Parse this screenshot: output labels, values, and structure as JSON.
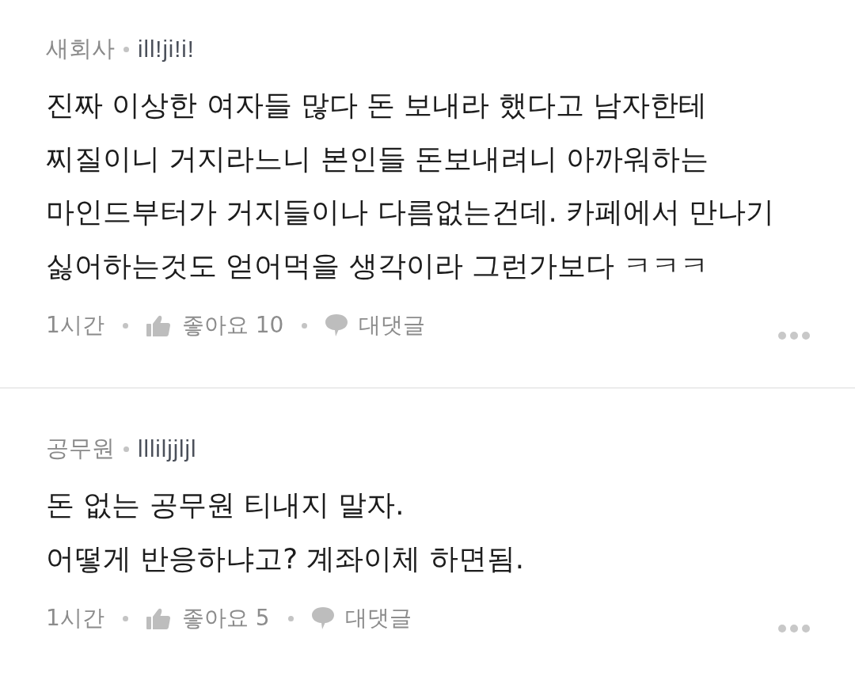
{
  "comments": [
    {
      "author": "새회사",
      "nickname": "ill!ji!i!",
      "lines": [
        "진짜 이상한 여자들 많다 돈 보내라 했다고 남자한테",
        "찌질이니 거지라느니 본인들 돈보내려니 아까워하는",
        "마인드부터가 거지들이나 다름없는건데. 카페에서 만나기",
        "싫어하는것도 얻어먹을 생각이라 그런가보다 ㅋㅋㅋ"
      ],
      "time": "1시간",
      "likes": "좋아요 10",
      "reply": "대댓글"
    },
    {
      "author": "공무원",
      "nickname": "llliljjljl",
      "lines": [
        "돈 없는 공무원 티내지 말자.",
        "어떻게 반응하냐고? 계좌이체 하면됨."
      ],
      "time": "1시간",
      "likes": "좋아요 5",
      "reply": "대댓글"
    }
  ]
}
